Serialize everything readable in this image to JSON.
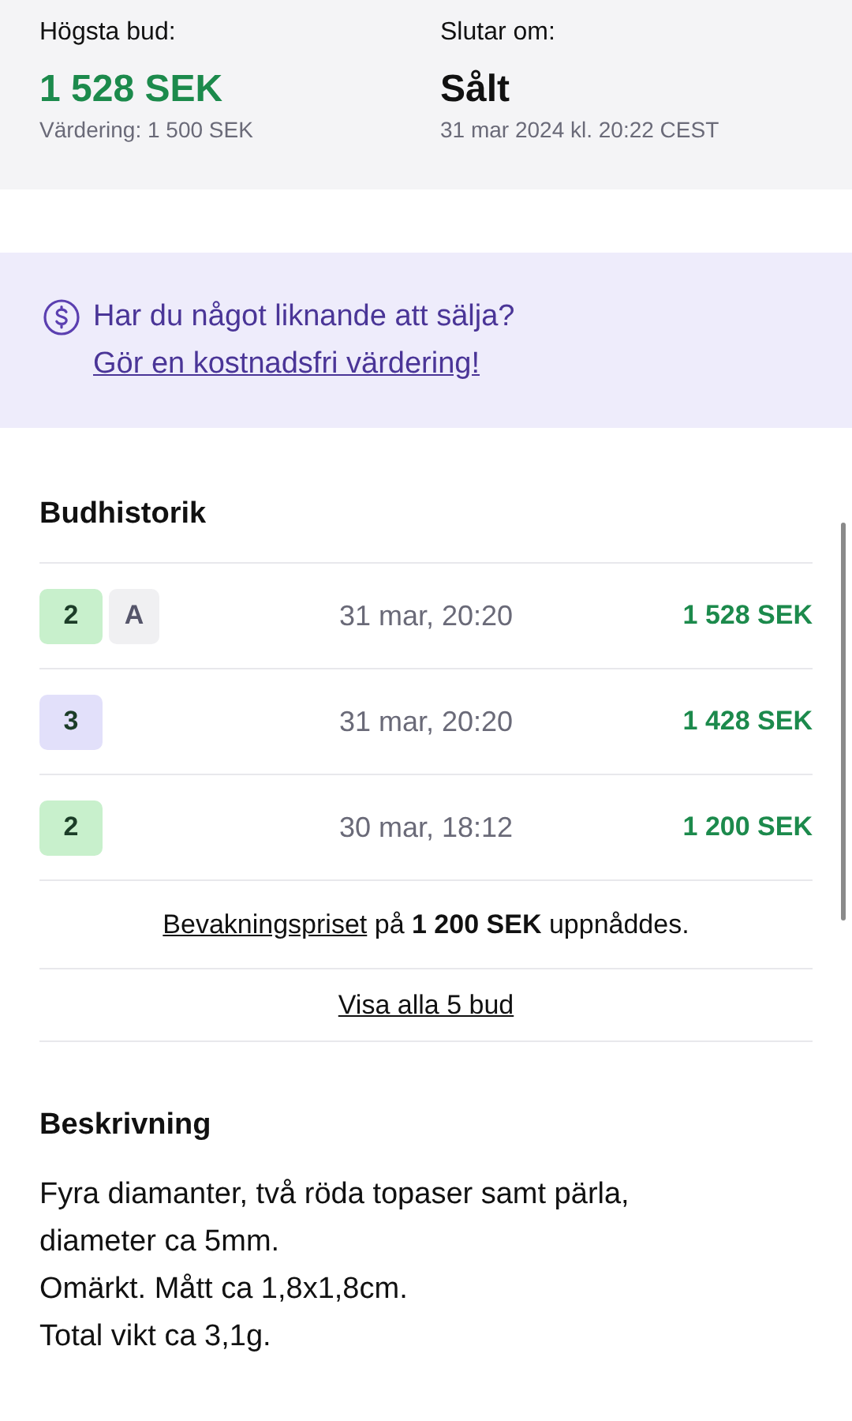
{
  "summary": [
    {
      "label": "Högsta bud:",
      "value": "1 528 SEK",
      "kind": "price",
      "note": "Värdering: 1 500 SEK"
    },
    {
      "label": "Slutar om:",
      "value": "Sålt",
      "kind": "status",
      "note": "31 mar 2024 kl. 20:22 CEST"
    }
  ],
  "promo": {
    "text": "Har du något liknande att sälja?",
    "link": "Gör en kostnadsfri värdering!"
  },
  "bid_history": {
    "title": "Budhistorik",
    "bids": [
      {
        "bidder": "2",
        "color": "#c8f0cc",
        "tag": "A",
        "time": "31 mar, 20:20",
        "amount": "1 528 SEK"
      },
      {
        "bidder": "3",
        "color": "#e2e0fa",
        "time": "31 mar, 20:20",
        "amount": "1 428 SEK"
      },
      {
        "bidder": "2",
        "color": "#c8f0cc",
        "time": "30 mar, 18:12",
        "amount": "1 200 SEK"
      }
    ],
    "reserve": {
      "link": "Bevakningspriset",
      "text": " på **1 200 SEK** uppnåddes."
    },
    "show_all": "Visa alla 5 bud"
  },
  "description": {
    "title": "Beskrivning",
    "lines": [
      "Fyra diamanter, två röda topaser samt pärla,",
      "diameter ca 5mm.",
      "Omärkt. Mått ca 1,8x1,8cm.",
      "Total vikt ca 3,1g."
    ]
  }
}
